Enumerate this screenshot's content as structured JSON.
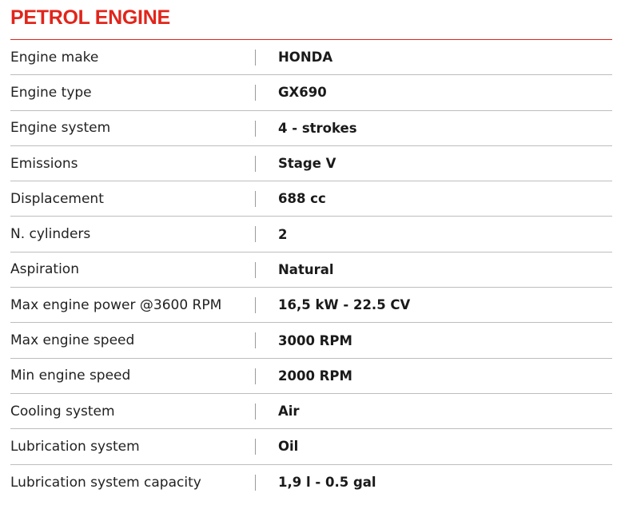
{
  "header": {
    "title": "PETROL ENGINE"
  },
  "rows": [
    {
      "label": "Engine make",
      "value": "HONDA"
    },
    {
      "label": "Engine type",
      "value": "GX690"
    },
    {
      "label": "Engine system",
      "value": "4 - strokes"
    },
    {
      "label": "Emissions",
      "value": "Stage V"
    },
    {
      "label": "Displacement",
      "value": "688 cc"
    },
    {
      "label": "N. cylinders",
      "value": "2"
    },
    {
      "label": "Aspiration",
      "value": "Natural"
    },
    {
      "label": "Max engine power @3600 RPM",
      "value": "16,5 kW - 22.5 CV"
    },
    {
      "label": "Max engine speed",
      "value": "3000 RPM"
    },
    {
      "label": "Min engine speed",
      "value": "2000 RPM"
    },
    {
      "label": "Cooling system",
      "value": "Air"
    },
    {
      "label": "Lubrication system",
      "value": "Oil"
    },
    {
      "label": "Lubrication system capacity",
      "value": "1,9 l - 0.5 gal"
    }
  ],
  "colors": {
    "accent": "#e1251b",
    "divider": "#bdbdbd",
    "separator": "#9a9a9a"
  }
}
